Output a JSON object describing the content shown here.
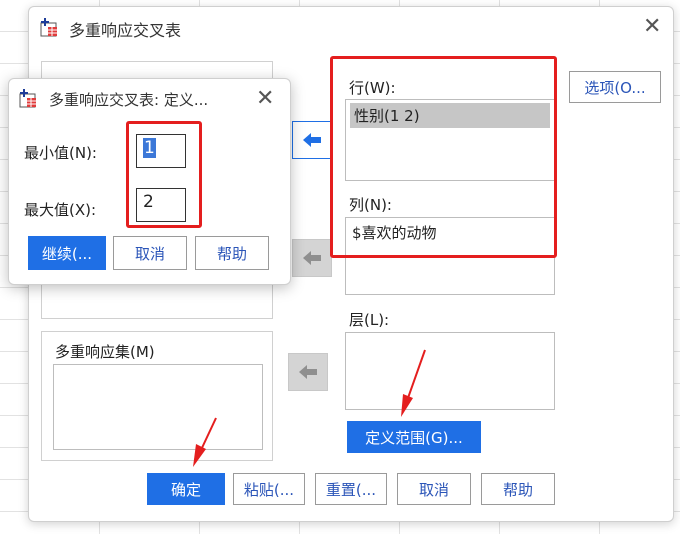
{
  "main_dialog": {
    "title": "多重响应交叉表",
    "rows_label": "行(W):",
    "rows_items": [
      "性别(1 2)"
    ],
    "cols_label": "列(N):",
    "cols_items": [
      "$喜欢的动物"
    ],
    "layers_label": "层(L):",
    "mr_sets_label": "多重响应集(M)",
    "options_button": "选项(O...",
    "define_ranges_button": "定义范围(G)...",
    "buttons": {
      "ok": "确定",
      "paste": "粘贴(...",
      "reset": "重置(...",
      "cancel": "取消",
      "help": "帮助"
    }
  },
  "sub_dialog": {
    "title": "多重响应交叉表: 定义...",
    "min_label": "最小值(N):",
    "min_value": "1",
    "max_label": "最大值(X):",
    "max_value": "2",
    "buttons": {
      "continue": "继续(...",
      "cancel": "取消",
      "help": "帮助"
    }
  },
  "colors": {
    "accent": "#1f6fe5",
    "annotation_red": "#e41e1e",
    "selected_item_bg": "#c6c6c6"
  }
}
